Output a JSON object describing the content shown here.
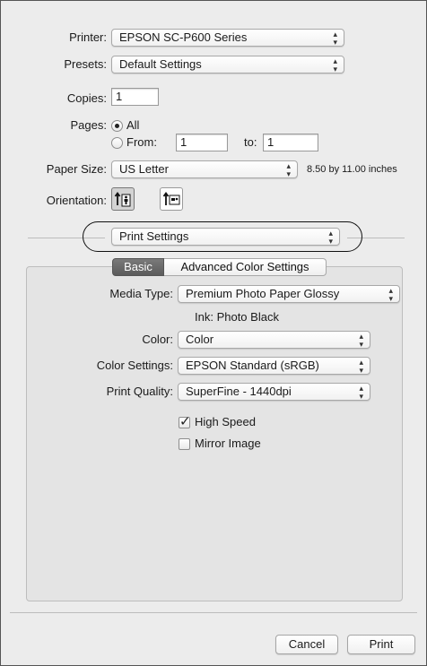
{
  "printer": {
    "label": "Printer:",
    "value": "EPSON SC-P600 Series"
  },
  "presets": {
    "label": "Presets:",
    "value": "Default Settings"
  },
  "copies": {
    "label": "Copies:",
    "value": "1"
  },
  "pages": {
    "label": "Pages:",
    "all_label": "All",
    "from_label": "From:",
    "from_value": "1",
    "to_label": "to:",
    "to_value": "1",
    "selected": "All"
  },
  "paper_size": {
    "label": "Paper Size:",
    "value": "US Letter",
    "dimensions": "8.50 by 11.00 inches"
  },
  "orientation": {
    "label": "Orientation:",
    "selected": "portrait"
  },
  "section_popup": {
    "value": "Print Settings"
  },
  "tabs": {
    "basic": "Basic",
    "advanced": "Advanced Color Settings",
    "selected": "Basic"
  },
  "media_type": {
    "label": "Media Type:",
    "value": "Premium Photo Paper Glossy"
  },
  "ink": {
    "text": "Ink: Photo Black"
  },
  "color": {
    "label": "Color:",
    "value": "Color"
  },
  "color_settings": {
    "label": "Color Settings:",
    "value": "EPSON Standard (sRGB)"
  },
  "print_quality": {
    "label": "Print Quality:",
    "value": "SuperFine - 1440dpi"
  },
  "options": {
    "high_speed": {
      "label": "High Speed",
      "checked": true
    },
    "mirror_image": {
      "label": "Mirror Image",
      "checked": false
    }
  },
  "buttons": {
    "cancel": "Cancel",
    "print": "Print"
  },
  "icons": {
    "popup_arrows": "up-down-arrows-icon",
    "portrait": "portrait-orientation-icon",
    "landscape": "landscape-orientation-icon",
    "checkmark": "checkmark-icon"
  }
}
